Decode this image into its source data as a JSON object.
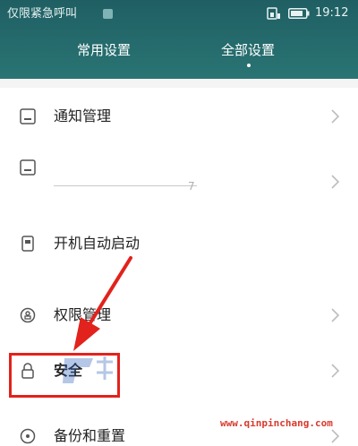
{
  "status_bar": {
    "carrier": "仅限紧急呼叫",
    "time": "19:12"
  },
  "tabs": [
    {
      "label": "常用设置",
      "active": false
    },
    {
      "label": "全部设置",
      "active": true
    }
  ],
  "settings": {
    "items": [
      {
        "label": "通知管理",
        "icon": "notification-icon"
      },
      {
        "label": "",
        "icon": "notification-icon"
      },
      {
        "label": "开机自动启动",
        "icon": "autostart-icon"
      },
      {
        "label": "权限管理",
        "icon": "permission-icon"
      },
      {
        "label": "安全",
        "icon": "lock-icon"
      },
      {
        "label": "备份和重置",
        "icon": "backup-icon"
      }
    ]
  },
  "annotation": {
    "watermark": "www.qinpinchang.com",
    "highlight_color": "#e2221c"
  },
  "colors": {
    "header": "#2a7474",
    "text": "#222222",
    "divider": "#e3e3e3"
  }
}
